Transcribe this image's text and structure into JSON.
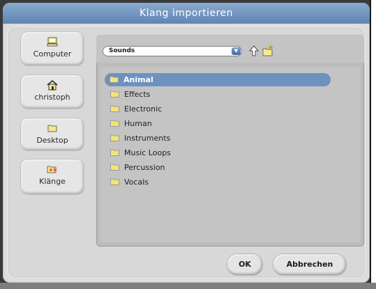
{
  "dialog": {
    "title": "Klang importieren"
  },
  "sidebar": {
    "items": [
      {
        "label": "Computer",
        "icon": "computer-icon"
      },
      {
        "label": "christoph",
        "icon": "home-icon"
      },
      {
        "label": "Desktop",
        "icon": "folder-icon"
      },
      {
        "label": "Klänge",
        "icon": "sound-folder-icon"
      }
    ]
  },
  "browser": {
    "path": "Sounds",
    "folders": [
      {
        "label": "Animal",
        "selected": true
      },
      {
        "label": "Effects"
      },
      {
        "label": "Electronic"
      },
      {
        "label": "Human"
      },
      {
        "label": "Instruments"
      },
      {
        "label": "Music Loops"
      },
      {
        "label": "Percussion"
      },
      {
        "label": "Vocals"
      }
    ]
  },
  "buttons": {
    "ok": "OK",
    "cancel": "Abbrechen"
  },
  "colors": {
    "title_bar": "#6f93c1",
    "selection": "#6d92bf",
    "folder": "#f4e37a"
  }
}
